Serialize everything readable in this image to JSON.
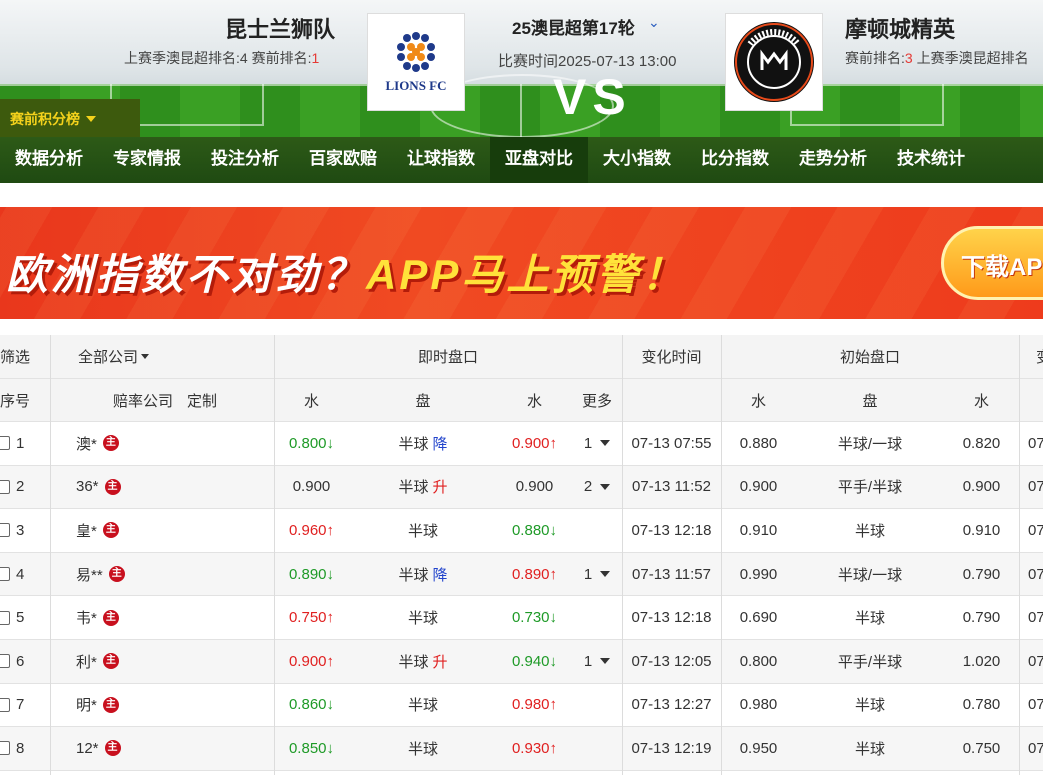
{
  "match": {
    "home_team": "昆士兰狮队",
    "home_sub_prefix": "上赛季澳昆超排名:4   赛前排名:",
    "home_rank": "1",
    "home_logo_text": "LIONS FC",
    "away_team": "摩顿城精英",
    "away_sub_prefix": "赛前排名:",
    "away_rank": "3",
    "away_sub_suffix": "  上赛季澳昆超排名",
    "away_logo_text": "MORETON CITY EXCELSIOR · FOOTBALL CLUB",
    "round": "25澳昆超第17轮",
    "time": "比赛时间2025-07-13 13:00",
    "vs": "VS"
  },
  "standings_button": "赛前积分榜",
  "nav": [
    "数据分析",
    "专家情报",
    "投注分析",
    "百家欧赔",
    "让球指数",
    "亚盘对比",
    "大小指数",
    "比分指数",
    "走势分析",
    "技术统计"
  ],
  "nav_active_index": 5,
  "banner": {
    "text_part1": "欧洲指数不对劲？",
    "text_part2": "APP马上预警！",
    "button": "下载AP"
  },
  "table": {
    "header1": {
      "filter": "筛选",
      "company_select": "全部公司",
      "live": "即时盘口",
      "change_time": "变化时间",
      "initial": "初始盘口",
      "trailing": "变"
    },
    "header2": {
      "index": "序号",
      "company": "赔率公司",
      "custom": "定制",
      "water1": "水",
      "handicap": "盘",
      "water2": "水",
      "more": "更多",
      "init_water1": "水",
      "init_handicap": "盘",
      "init_water2": "水"
    },
    "host_icon": "主",
    "rows": [
      {
        "no": "1",
        "company": "澳*",
        "w1": "0.800",
        "w1_dir": "down",
        "hc": "半球",
        "hc_tag": "降",
        "w2": "0.900",
        "w2_dir": "up",
        "more": "1",
        "time": "07-13 07:55",
        "iw1": "0.880",
        "ihc": "半球/一球",
        "iw2": "0.820",
        "tail": "07"
      },
      {
        "no": "2",
        "company": "36*",
        "w1": "0.900",
        "w1_dir": "",
        "hc": "半球",
        "hc_tag": "升",
        "w2": "0.900",
        "w2_dir": "",
        "more": "2",
        "time": "07-13 11:52",
        "iw1": "0.900",
        "ihc": "平手/半球",
        "iw2": "0.900",
        "tail": "07"
      },
      {
        "no": "3",
        "company": "皇*",
        "w1": "0.960",
        "w1_dir": "up",
        "hc": "半球",
        "hc_tag": "",
        "w2": "0.880",
        "w2_dir": "down",
        "more": "",
        "time": "07-13 12:18",
        "iw1": "0.910",
        "ihc": "半球",
        "iw2": "0.910",
        "tail": "07"
      },
      {
        "no": "4",
        "company": "易**",
        "w1": "0.890",
        "w1_dir": "down",
        "hc": "半球",
        "hc_tag": "降",
        "w2": "0.890",
        "w2_dir": "up",
        "more": "1",
        "time": "07-13 11:57",
        "iw1": "0.990",
        "ihc": "半球/一球",
        "iw2": "0.790",
        "tail": "07"
      },
      {
        "no": "5",
        "company": "韦*",
        "w1": "0.750",
        "w1_dir": "up",
        "hc": "半球",
        "hc_tag": "",
        "w2": "0.730",
        "w2_dir": "down",
        "more": "",
        "time": "07-13 12:18",
        "iw1": "0.690",
        "ihc": "半球",
        "iw2": "0.790",
        "tail": "07"
      },
      {
        "no": "6",
        "company": "利*",
        "w1": "0.900",
        "w1_dir": "up",
        "hc": "半球",
        "hc_tag": "升",
        "w2": "0.940",
        "w2_dir": "down",
        "more": "1",
        "time": "07-13 12:05",
        "iw1": "0.800",
        "ihc": "平手/半球",
        "iw2": "1.020",
        "tail": "07"
      },
      {
        "no": "7",
        "company": "明*",
        "w1": "0.860",
        "w1_dir": "down",
        "hc": "半球",
        "hc_tag": "",
        "w2": "0.980",
        "w2_dir": "up",
        "more": "",
        "time": "07-13 12:27",
        "iw1": "0.980",
        "ihc": "半球",
        "iw2": "0.780",
        "tail": "07"
      },
      {
        "no": "8",
        "company": "12*",
        "w1": "0.850",
        "w1_dir": "down",
        "hc": "半球",
        "hc_tag": "",
        "w2": "0.930",
        "w2_dir": "up",
        "more": "",
        "time": "07-13 12:19",
        "iw1": "0.950",
        "ihc": "半球",
        "iw2": "0.750",
        "tail": "07"
      }
    ]
  },
  "colors": {
    "up": "#e02020",
    "down": "#1e9a27",
    "nav_bg": "#1f4a12",
    "banner": "#ee3b1c",
    "accent_yellow": "#f4d21c"
  }
}
